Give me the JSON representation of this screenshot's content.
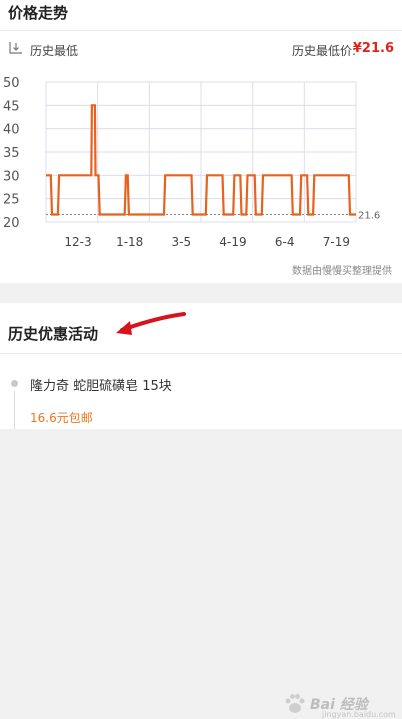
{
  "price_section": {
    "title": "价格走势",
    "history_label": "历史最低",
    "lowest_label": "历史最低价:",
    "lowest_value": "¥21.6",
    "credit": "数据由慢慢买整理提供"
  },
  "chart_data": {
    "type": "line",
    "ylim": [
      20,
      50
    ],
    "y_ticks": [
      20,
      25,
      30,
      35,
      40,
      45,
      50
    ],
    "x_tick_labels": [
      "12-3",
      "1-18",
      "3-5",
      "4-19",
      "6-4",
      "7-19"
    ],
    "min_marker_label": "21.6",
    "min_value": 21.6,
    "line_color": "#e8611d",
    "series": [
      {
        "x": [
          0,
          0.4,
          0.5,
          1,
          1.1,
          3.8,
          3.85,
          4.1,
          4.15,
          4.4,
          4.5,
          6.6,
          6.7,
          6.85,
          6.95,
          9.9,
          10,
          12.2,
          12.3,
          13.4,
          13.5,
          14.8,
          14.9,
          15.7,
          15.8,
          16.3,
          16.4,
          16.8,
          16.9,
          17.5,
          17.6,
          18.1,
          18.2,
          20.6,
          20.7,
          21.3,
          21.4,
          21.9,
          22,
          22.4,
          22.5,
          25.4,
          25.5,
          26
        ],
        "values": [
          30,
          30,
          21.6,
          21.6,
          30,
          30,
          45,
          45,
          30,
          30,
          21.6,
          21.6,
          30,
          30,
          21.6,
          21.6,
          30,
          30,
          21.6,
          21.6,
          30,
          30,
          21.6,
          21.6,
          30,
          30,
          21.6,
          21.6,
          30,
          30,
          21.6,
          21.6,
          30,
          30,
          21.6,
          21.6,
          30,
          30,
          21.6,
          21.6,
          30,
          30,
          21.6,
          21.6
        ]
      }
    ]
  },
  "promo_section": {
    "title": "历史优惠活动",
    "item_name": "隆力奇 蛇胆硫磺皂 15块",
    "item_price": "16.6元包邮"
  },
  "watermark": {
    "text": "Bai 经验",
    "sub": "jingyan.baidu.com"
  }
}
